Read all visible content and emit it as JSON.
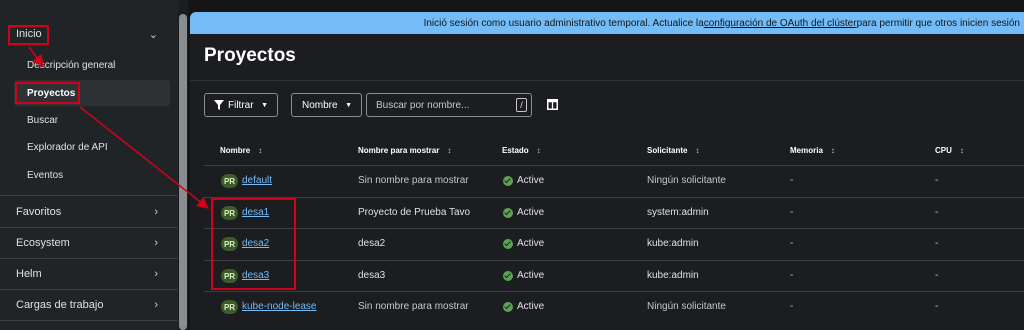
{
  "sidebar": {
    "sections": [
      {
        "label": "Inicio",
        "chevron": "chevron-down-icon"
      },
      {
        "label": "Favoritos",
        "chevron": "chevron-right-icon"
      },
      {
        "label": "Ecosystem",
        "chevron": "chevron-right-icon"
      },
      {
        "label": "Helm",
        "chevron": "chevron-right-icon"
      },
      {
        "label": "Cargas de trabajo",
        "chevron": "chevron-right-icon"
      }
    ],
    "inicio_items": [
      {
        "label": "Descripción general"
      },
      {
        "label": "Proyectos",
        "active": true
      },
      {
        "label": "Buscar"
      },
      {
        "label": "Explorador de API"
      },
      {
        "label": "Eventos"
      }
    ]
  },
  "banner": {
    "text_before": "Inició sesión como usuario administrativo temporal. Actualice la ",
    "link": "configuración de OAuth del clúster",
    "text_after": " para permitir que otros inicien sesión"
  },
  "page": {
    "title": "Proyectos"
  },
  "toolbar": {
    "filter_label": "Filtrar",
    "select_label": "Nombre",
    "search_placeholder": "Buscar por nombre...",
    "search_shortcut": "/",
    "columns_icon": "columns-icon"
  },
  "table": {
    "headers": [
      "Nombre",
      "Nombre para mostrar",
      "Estado",
      "Solicitante",
      "Memoria",
      "CPU"
    ],
    "rows": [
      {
        "badge": "PR",
        "name": "default",
        "display": "Sin nombre para mostrar",
        "status": "Active",
        "requester": "Ningún solicitante",
        "memory": "-",
        "cpu": "-"
      },
      {
        "badge": "PR",
        "name": "desa1",
        "display": "Proyecto de Prueba Tavo",
        "status": "Active",
        "requester": "system:admin",
        "memory": "-",
        "cpu": "-"
      },
      {
        "badge": "PR",
        "name": "desa2",
        "display": "desa2",
        "status": "Active",
        "requester": "kube:admin",
        "memory": "-",
        "cpu": "-"
      },
      {
        "badge": "PR",
        "name": "desa3",
        "display": "desa3",
        "status": "Active",
        "requester": "kube:admin",
        "memory": "-",
        "cpu": "-"
      },
      {
        "badge": "PR",
        "name": "kube-node-lease",
        "display": "Sin nombre para mostrar",
        "status": "Active",
        "requester": "Ningún solicitante",
        "memory": "-",
        "cpu": "-"
      }
    ]
  },
  "colors": {
    "accent_link": "#73bcf7",
    "banner_bg": "#73bcf7",
    "status_ok": "#5ba352",
    "annotation": "#d0021b"
  }
}
